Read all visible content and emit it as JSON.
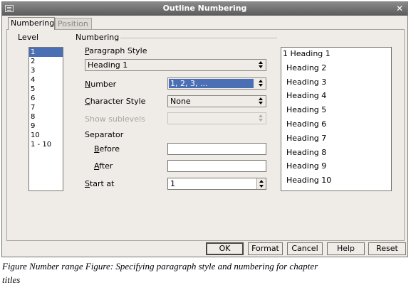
{
  "window": {
    "title": "Outline Numbering"
  },
  "tabs": [
    {
      "label": "Numbering",
      "active": true
    },
    {
      "label": "Position",
      "active": false
    }
  ],
  "level": {
    "header": "Level",
    "items": [
      "1",
      "2",
      "3",
      "4",
      "5",
      "6",
      "7",
      "8",
      "9",
      "10",
      "1 - 10"
    ],
    "selected_index": 0
  },
  "numbering": {
    "header": "Numbering",
    "paragraph_style": {
      "label": "Paragraph Style",
      "value": "Heading 1"
    },
    "number": {
      "label": "Number",
      "value": "1, 2, 3, ..."
    },
    "character_style": {
      "label": "Character Style",
      "value": "None"
    },
    "show_sublevels": {
      "label": "Show sublevels",
      "value": ""
    },
    "separator": {
      "label": "Separator",
      "before": {
        "label": "Before",
        "value": ""
      },
      "after": {
        "label": "After",
        "value": ""
      }
    },
    "start_at": {
      "label": "Start at",
      "value": "1"
    }
  },
  "preview": {
    "lines": [
      "1 Heading 1",
      "Heading 2",
      "Heading 3",
      "Heading 4",
      "Heading 5",
      "Heading 6",
      "Heading 7",
      "Heading 8",
      "Heading 9",
      "Heading 10"
    ]
  },
  "buttons": {
    "ok": "OK",
    "format": "Format",
    "cancel": "Cancel",
    "help": "Help",
    "reset": "Reset"
  },
  "caption": {
    "line1": "Figure Number range Figure: Specifying paragraph style and numbering for chapter",
    "line2": "titles"
  },
  "colors": {
    "dialog_bg": "#efebe7",
    "titlebar": "#6e6e6e",
    "selection": "#4a6fb5"
  }
}
